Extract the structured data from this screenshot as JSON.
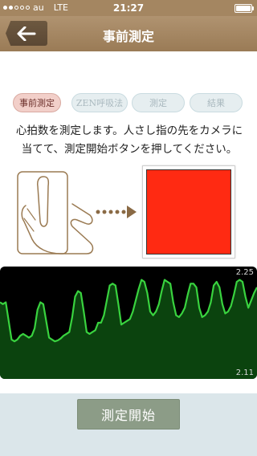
{
  "status_bar": {
    "carrier": "au",
    "network": "LTE",
    "time": "21:27",
    "signal_bars": 2,
    "signal_total": 5
  },
  "nav": {
    "title": "事前測定",
    "back_icon": "arrow-left-icon"
  },
  "steps": [
    {
      "label": "事前測定",
      "active": true
    },
    {
      "label": "ZEN呼吸法",
      "active": false
    },
    {
      "label": "測定",
      "active": false
    },
    {
      "label": "結果",
      "active": false
    }
  ],
  "instruction": {
    "line1": "心拍数を測定します。人さし指の先をカメラに",
    "line2": "当てて、測定開始ボタンを押してください。"
  },
  "camera": {
    "preview_color": "#ff2a12"
  },
  "graph": {
    "max_label": "2.25",
    "min_label": "2.11",
    "line_color": "#39d33f",
    "samples": [
      0.72,
      0.7,
      0.72,
      0.52,
      0.32,
      0.3,
      0.32,
      0.36,
      0.38,
      0.36,
      0.34,
      0.36,
      0.44,
      0.64,
      0.72,
      0.7,
      0.52,
      0.34,
      0.32,
      0.3,
      0.31,
      0.33,
      0.36,
      0.38,
      0.4,
      0.56,
      0.78,
      0.84,
      0.82,
      0.62,
      0.4,
      0.38,
      0.4,
      0.42,
      0.5,
      0.5,
      0.58,
      0.74,
      0.9,
      0.92,
      0.9,
      0.7,
      0.48,
      0.5,
      0.52,
      0.54,
      0.62,
      0.74,
      0.86,
      0.96,
      0.94,
      0.82,
      0.62,
      0.58,
      0.62,
      0.7,
      0.84,
      0.96,
      0.94,
      0.92,
      0.72,
      0.58,
      0.56,
      0.6,
      0.66,
      0.8,
      0.92,
      0.92,
      0.88,
      0.66,
      0.56,
      0.58,
      0.62,
      0.72,
      0.9,
      0.94,
      0.88,
      0.7,
      0.6,
      0.62,
      0.68,
      0.8,
      0.94,
      0.96,
      0.94,
      0.78,
      0.66,
      0.74,
      0.82,
      0.88
    ]
  },
  "footer": {
    "start_label": "測定開始"
  },
  "colors": {
    "brown": "#a48661",
    "button_green": "#8c9c87",
    "footer_bg": "#dbe6ea"
  }
}
